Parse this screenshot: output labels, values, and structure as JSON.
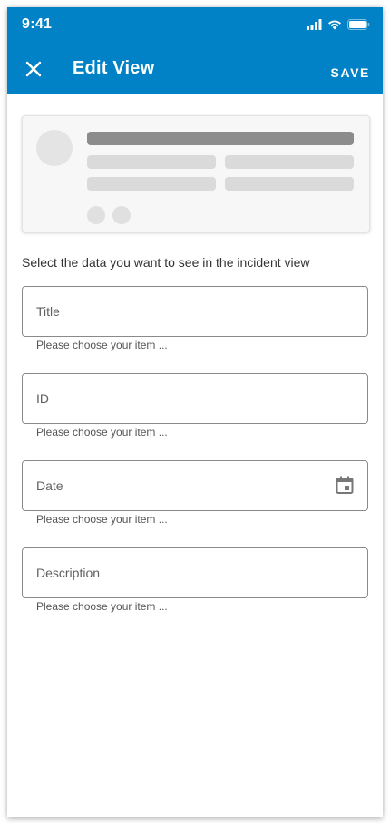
{
  "status_bar": {
    "time": "9:41"
  },
  "app_bar": {
    "title": "Edit View",
    "save_label": "SAVE"
  },
  "instruction": "Select the data you want to see in the incident view",
  "fields": [
    {
      "label": "Title",
      "hint": "Please choose your item ..."
    },
    {
      "label": "ID",
      "hint": "Please choose your item ..."
    },
    {
      "label": "Date",
      "hint": "Please choose your item ..."
    },
    {
      "label": "Description",
      "hint": "Please choose your item ..."
    }
  ],
  "icons": {
    "close": "close-icon",
    "calendar": "calendar-icon",
    "signal": "signal-icon",
    "wifi": "wifi-icon",
    "battery": "battery-icon"
  },
  "colors": {
    "primary": "#0282c6",
    "border": "#8a8a8a",
    "skeleton_dark": "#8c8c8c",
    "skeleton_light": "#dadada"
  }
}
